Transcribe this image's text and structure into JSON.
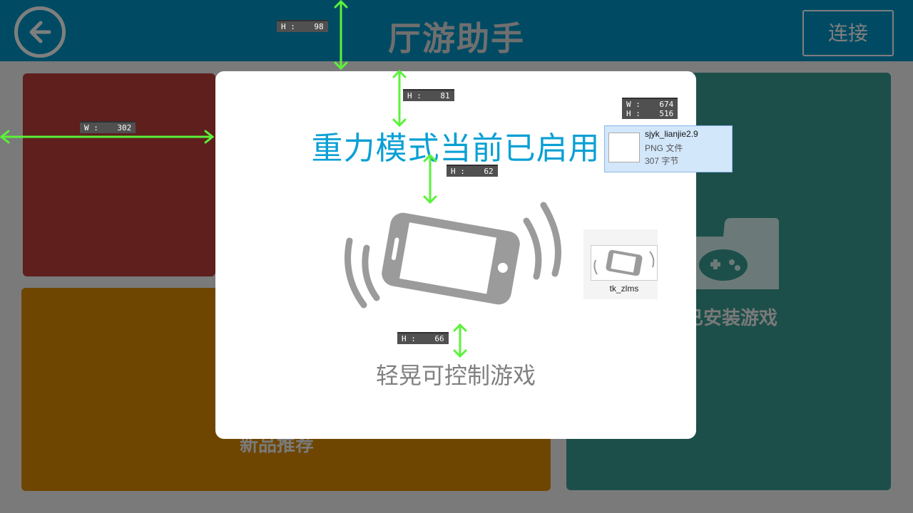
{
  "header": {
    "title": "厅游助手",
    "connect_label": "连接"
  },
  "tiles": {
    "new_products": "新品推荐",
    "installed_games": "已安装游戏"
  },
  "modal": {
    "title": "重力模式当前已启用",
    "subtitle": "轻晃可控制游戏"
  },
  "measure_tags": {
    "header_h": "H :    98",
    "top_gap_h": "H :    81",
    "left_w": "W :    302",
    "dialog_wh": "W :    674\nH :    516",
    "title_gap_h": "H :    62",
    "phone_gap_h": "H :    66"
  },
  "file_card": {
    "name": "sjyk_lianjie2.9",
    "type": "PNG 文件",
    "size": "307 字节"
  },
  "thumbnail": {
    "label": "tk_zlms"
  },
  "colors": {
    "header": "#004b63",
    "accent_title": "#0aa0d4",
    "guide": "#5bf23a"
  },
  "icons": [
    "back-arrow-icon",
    "phone-shake-icon",
    "game-folder-icon"
  ]
}
